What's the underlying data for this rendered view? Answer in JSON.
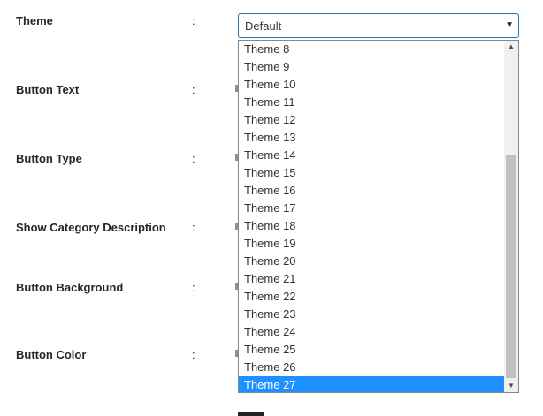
{
  "fields": {
    "theme": {
      "label": "Theme",
      "colon": ":"
    },
    "button_text": {
      "label": "Button Text",
      "colon": ":"
    },
    "button_type": {
      "label": "Button Type",
      "colon": ":"
    },
    "show_category_description": {
      "label": "Show Category Description",
      "colon": ":"
    },
    "button_background": {
      "label": "Button Background",
      "colon": ":"
    },
    "button_color": {
      "label": "Button Color",
      "colon": ":"
    }
  },
  "theme_select": {
    "value": "Default",
    "caret": "▼",
    "options": [
      "Theme 8",
      "Theme 9",
      "Theme 10",
      "Theme 11",
      "Theme 12",
      "Theme 13",
      "Theme 14",
      "Theme 15",
      "Theme 16",
      "Theme 17",
      "Theme 18",
      "Theme 19",
      "Theme 20",
      "Theme 21",
      "Theme 22",
      "Theme 23",
      "Theme 24",
      "Theme 25",
      "Theme 26",
      "Theme 27"
    ],
    "highlighted": "Theme 27",
    "scroll_up": "▲",
    "scroll_down": "▼"
  },
  "colors": {
    "accent": "#1e90ff",
    "focus_border": "#2271b1"
  }
}
